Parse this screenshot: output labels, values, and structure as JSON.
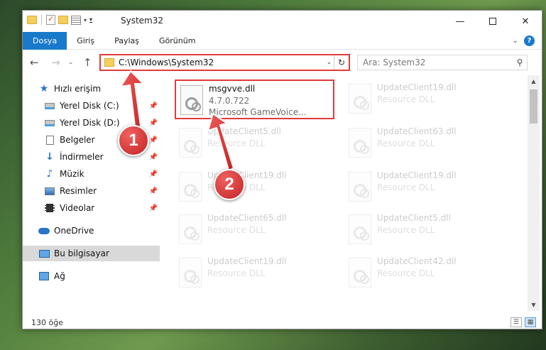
{
  "window": {
    "title": "System32",
    "minimize": "—",
    "close": "✕"
  },
  "ribbon": {
    "tabs": [
      "Dosya",
      "Giriş",
      "Paylaş",
      "Görünüm"
    ],
    "help": "?"
  },
  "address": {
    "path": "C:\\Windows\\System32",
    "search_placeholder": "Ara: System32"
  },
  "nav": {
    "quick_access": "Hızlı erişim",
    "items": [
      {
        "label": "Yerel Disk (C:)",
        "icon": "drive-icon",
        "pinned": true
      },
      {
        "label": "Yerel Disk (D:)",
        "icon": "drive-icon",
        "pinned": true
      },
      {
        "label": "Belgeler",
        "icon": "documents-icon",
        "pinned": true
      },
      {
        "label": "İndirmeler",
        "icon": "download-icon",
        "pinned": true
      },
      {
        "label": "Müzik",
        "icon": "music-icon",
        "pinned": true
      },
      {
        "label": "Resimler",
        "icon": "pictures-icon",
        "pinned": true
      },
      {
        "label": "Videolar",
        "icon": "videos-icon",
        "pinned": true
      }
    ],
    "onedrive": "OneDrive",
    "this_pc": "Bu bilgisayar",
    "network": "Ağ"
  },
  "files": [
    {
      "name": "msgvve.dll",
      "line2": "4.7.0.722",
      "line3": "Microsoft GameVoice...",
      "highlight": true
    },
    {
      "name": "UpdateClient19.dll",
      "line2": "Resource DLL"
    },
    {
      "name": "UpdateClient5.dll",
      "line2": "Resource DLL"
    },
    {
      "name": "UpdateClient63.dll",
      "line2": "Resource DLL"
    },
    {
      "name": "UpdateClient19.dll",
      "line2": "Resource DLL"
    },
    {
      "name": "UpdateClient19.dll",
      "line2": "Resource DLL"
    },
    {
      "name": "UpdateClient65.dll",
      "line2": "Resource DLL"
    },
    {
      "name": "UpdateClient5.dll",
      "line2": "Resource DLL"
    },
    {
      "name": "UpdateClient19.dll",
      "line2": "Resource DLL"
    },
    {
      "name": "UpdateClient42.dll",
      "line2": "Resource DLL"
    }
  ],
  "status": {
    "count": "130 öğe"
  },
  "annotations": {
    "badge1": "1",
    "badge2": "2",
    "color": "#e23b3b"
  }
}
